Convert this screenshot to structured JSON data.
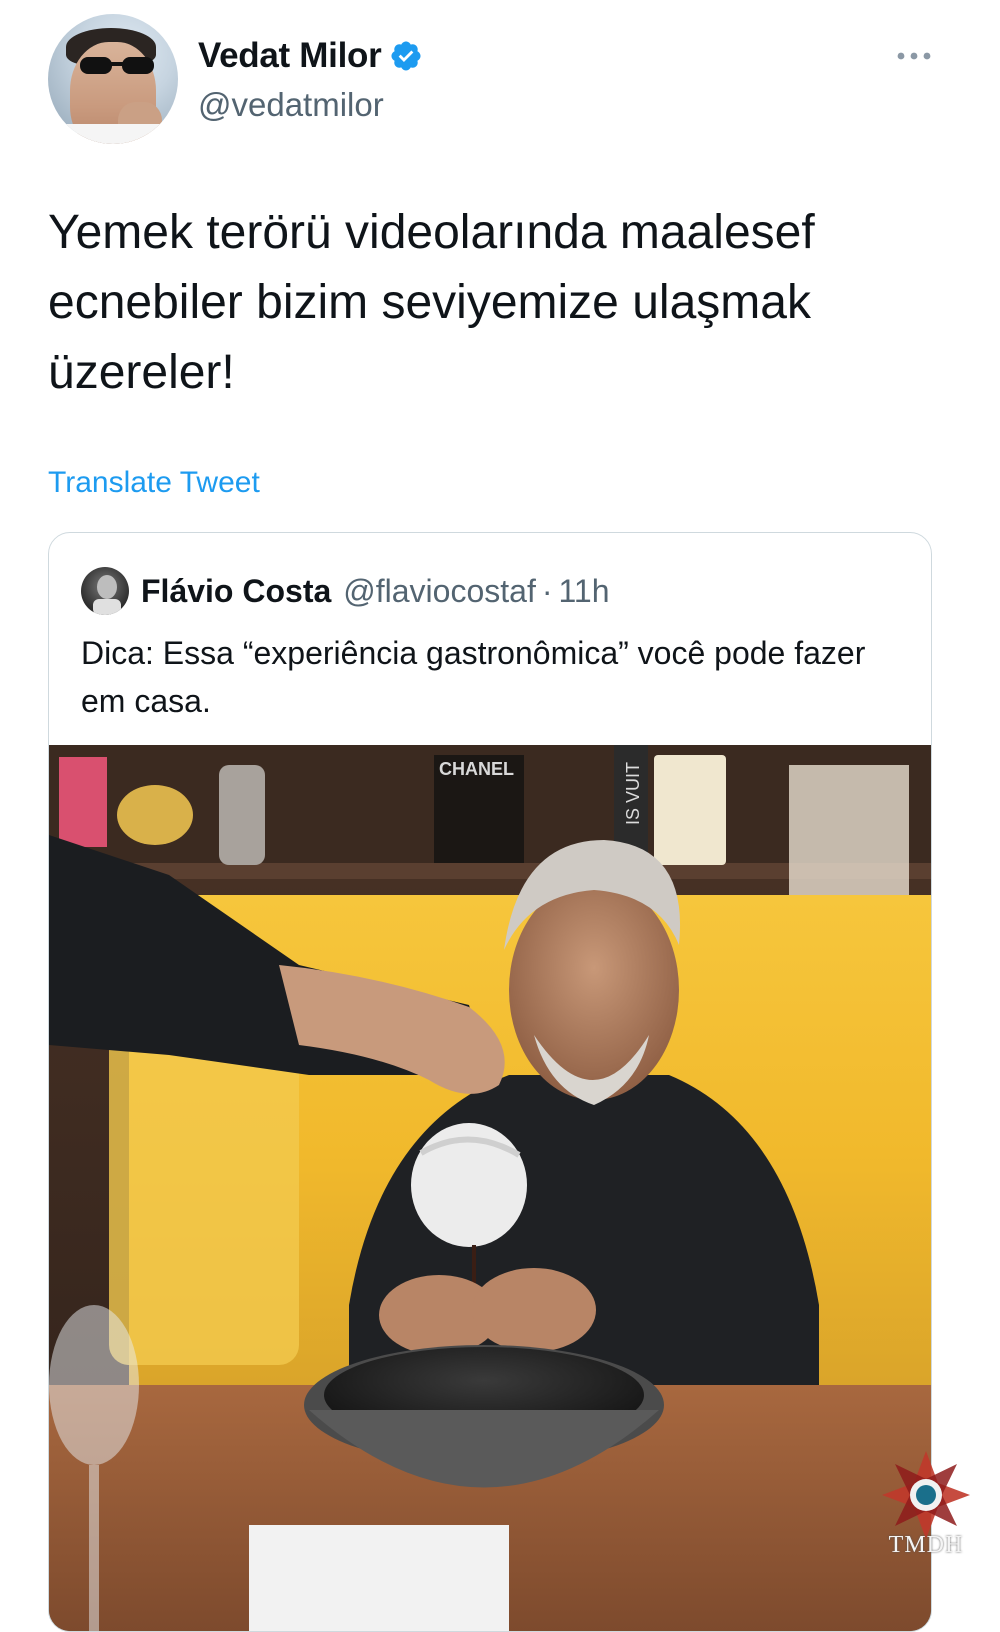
{
  "tweet": {
    "author": {
      "display_name": "Vedat Milor",
      "handle": "@vedatmilor",
      "verified": true
    },
    "text": "Yemek terörü videolarında maalesef\necnebiler bizim seviyemize ulaşmak\nüzereler!",
    "translate_label": "Translate Tweet",
    "more_icon": "more-horizontal-icon"
  },
  "quoted_tweet": {
    "author": {
      "display_name": "Flávio Costa",
      "handle": "@flaviocostaf"
    },
    "separator": "·",
    "time": "11h",
    "text": "Dica: Essa “experiência gastronômica” você pode fazer em casa.",
    "media": {
      "type": "video-still",
      "visible_text": [
        "CHANEL",
        "IS VUIT"
      ]
    }
  },
  "watermark": {
    "text": "TMDH"
  },
  "colors": {
    "accent": "#1d9bf0",
    "text_primary": "#0f1419",
    "text_secondary": "#536471",
    "border": "#cfd9de"
  }
}
